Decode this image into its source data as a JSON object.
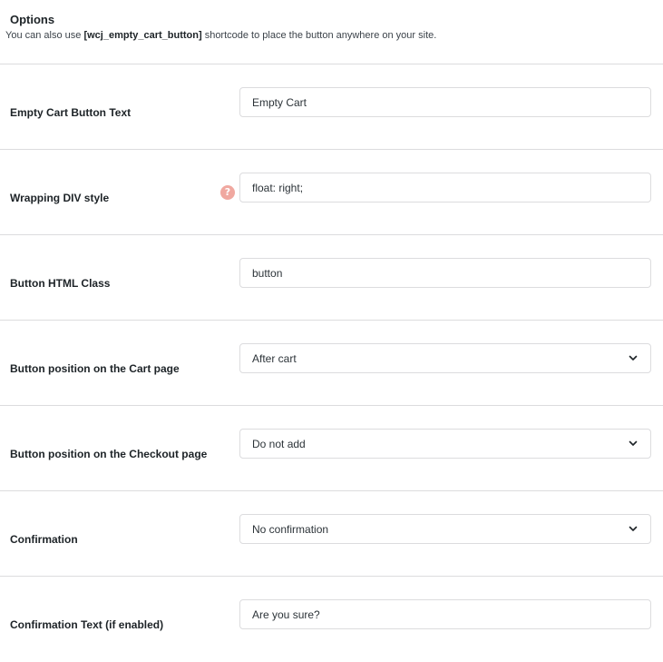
{
  "options": {
    "title": "Options",
    "desc_prefix": "You can also use ",
    "desc_code": "[wcj_empty_cart_button]",
    "desc_suffix": " shortcode to place the button anywhere on your site."
  },
  "fields": [
    {
      "label": "Empty Cart Button Text",
      "value": "Empty Cart",
      "kind": "text"
    },
    {
      "label": "Wrapping DIV style",
      "value": "float: right;",
      "kind": "text",
      "help_icon": "question-icon"
    },
    {
      "label": "Button HTML Class",
      "value": "button",
      "kind": "text"
    },
    {
      "label": "Button position on the Cart page",
      "value": "After cart",
      "kind": "select"
    },
    {
      "label": "Button position on the Checkout page",
      "value": "Do not add",
      "kind": "select"
    },
    {
      "label": "Confirmation",
      "value": "No confirmation",
      "kind": "select"
    },
    {
      "label": "Confirmation Text (if enabled)",
      "value": "Are you sure?",
      "kind": "text"
    }
  ],
  "colors": {
    "help_icon": "#f0a8a0",
    "border": "#dcdcde"
  }
}
